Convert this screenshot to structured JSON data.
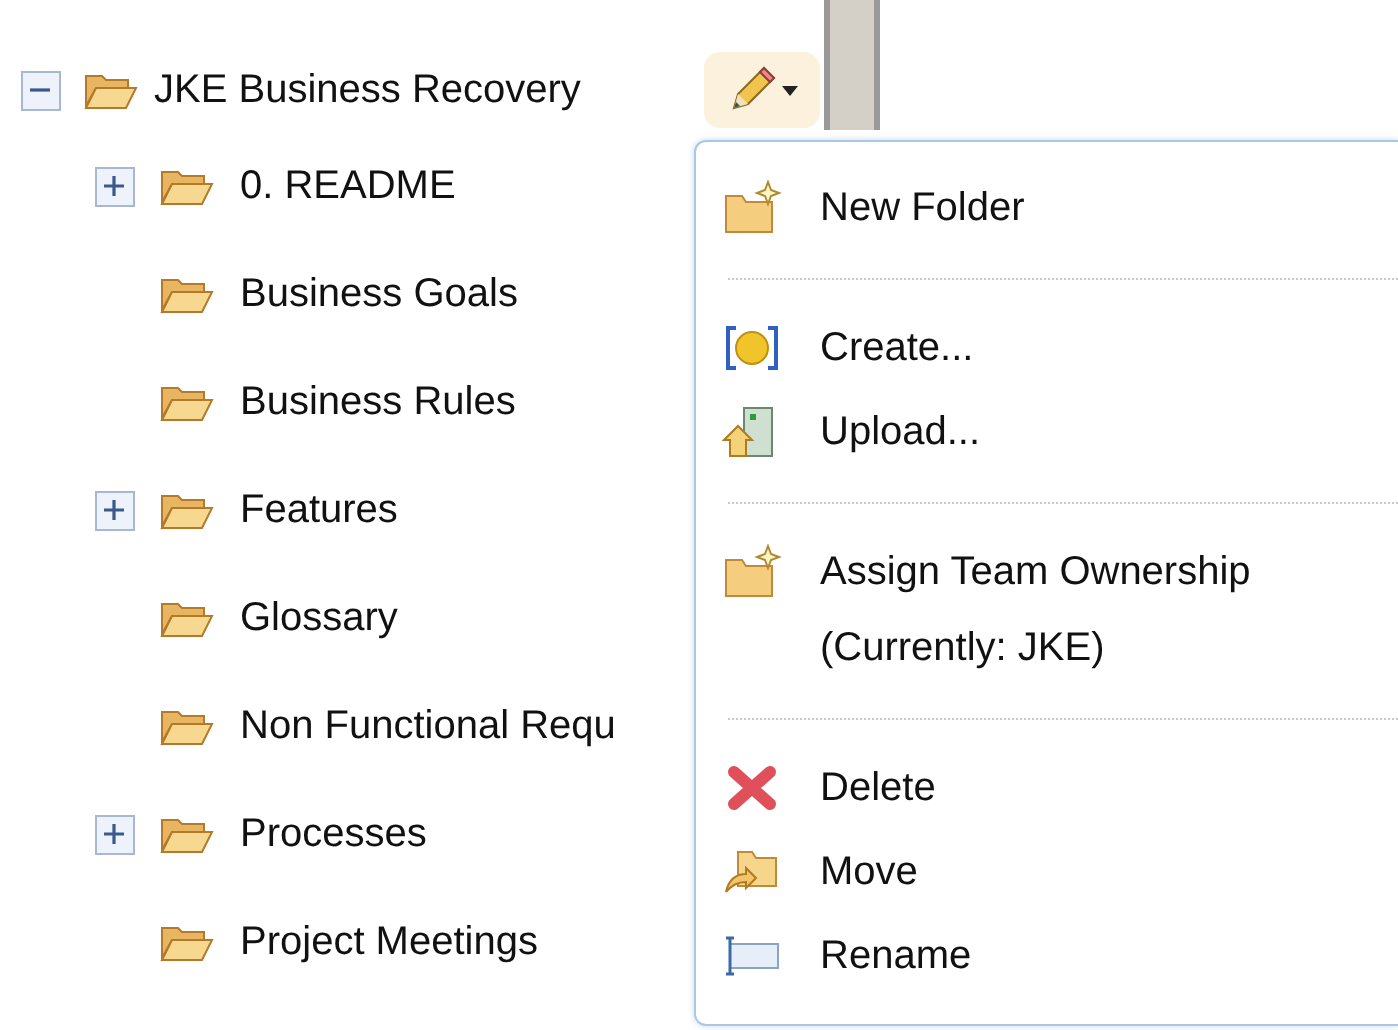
{
  "tree": {
    "label": "JKE Business Recovery",
    "expanded": true,
    "children": [
      {
        "kind": "branch",
        "label": "0. README",
        "expanded": false
      },
      {
        "kind": "leaf",
        "label": "Business Goals"
      },
      {
        "kind": "leaf",
        "label": "Business Rules"
      },
      {
        "kind": "branch",
        "label": "Features",
        "expanded": false
      },
      {
        "kind": "leaf",
        "label": "Glossary"
      },
      {
        "kind": "leaf",
        "label": "Non Functional Requ"
      },
      {
        "kind": "branch",
        "label": "Processes",
        "expanded": false
      },
      {
        "kind": "leaf",
        "label": "Project Meetings"
      }
    ]
  },
  "menu": {
    "sections": [
      [
        {
          "kind": "new-folder",
          "label": "New Folder"
        }
      ],
      [
        {
          "kind": "create",
          "label": "Create..."
        },
        {
          "kind": "upload",
          "label": "Upload..."
        }
      ],
      [
        {
          "kind": "assign",
          "label": "Assign Team Ownership",
          "detail": "(Currently: JKE)"
        }
      ],
      [
        {
          "kind": "delete",
          "label": "Delete"
        },
        {
          "kind": "move",
          "label": "Move"
        },
        {
          "kind": "rename",
          "label": "Rename"
        }
      ]
    ]
  }
}
